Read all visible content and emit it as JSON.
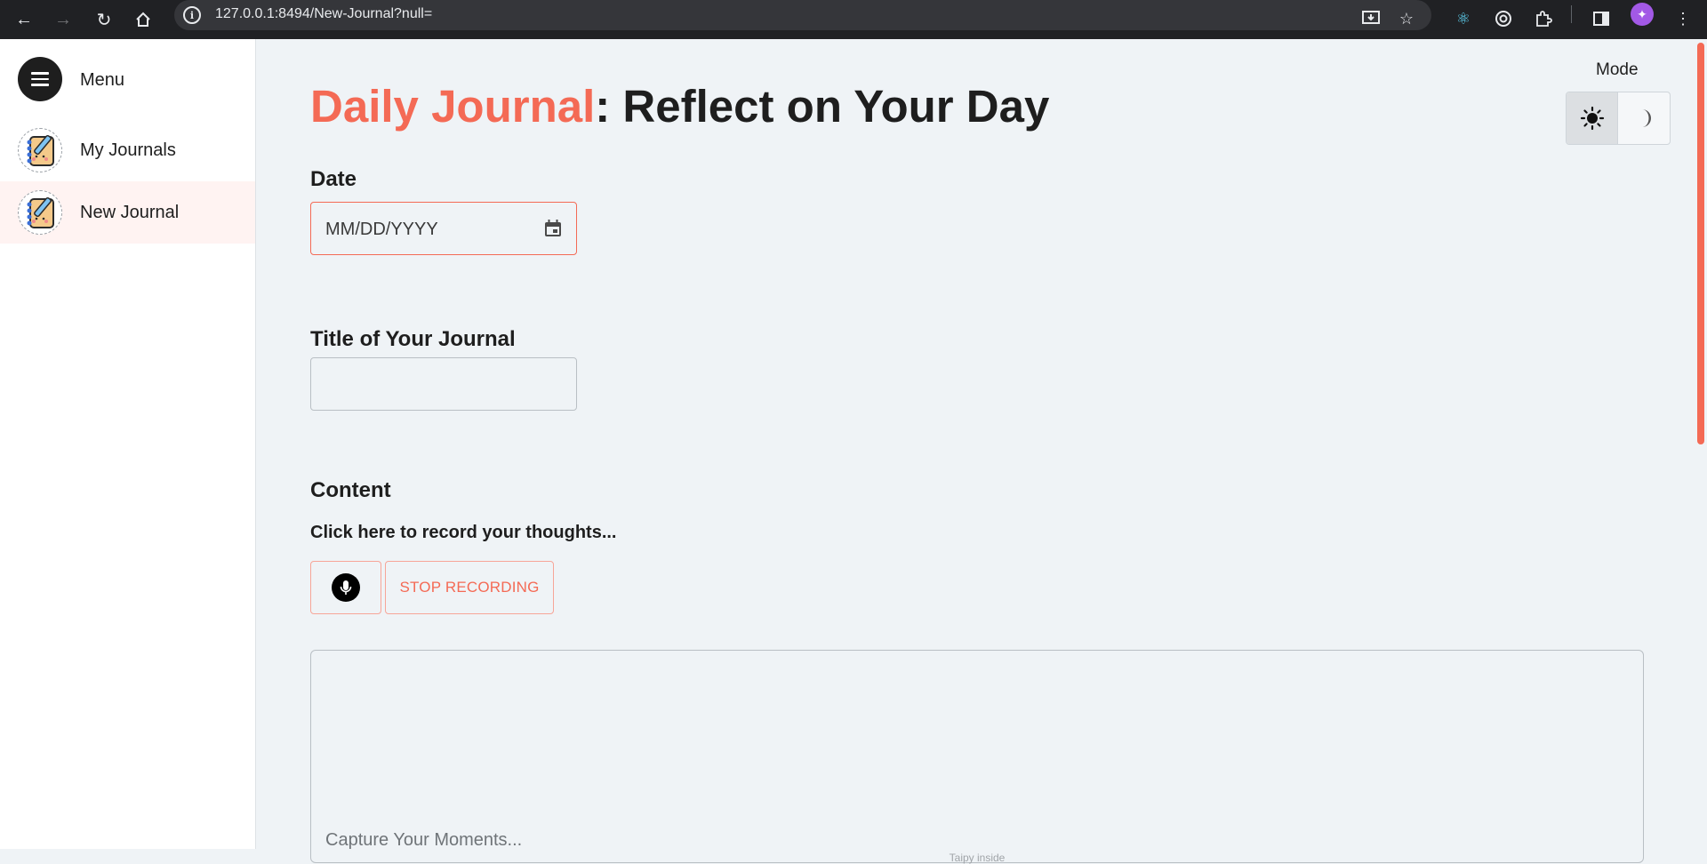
{
  "browser": {
    "url": "127.0.0.1:8494/New-Journal?null="
  },
  "sidebar": {
    "menu_label": "Menu",
    "items": [
      {
        "label": "My Journals",
        "icon": "journal-icon"
      },
      {
        "label": "New Journal",
        "icon": "journal-icon",
        "active": true
      }
    ]
  },
  "header": {
    "title_accent": "Daily Journal",
    "title_rest": ": Reflect on Your Day"
  },
  "mode": {
    "label": "Mode",
    "options": [
      "sun-icon",
      "moon-icon"
    ],
    "selected": "light"
  },
  "form": {
    "date_label": "Date",
    "date_placeholder": "MM/DD/YYYY",
    "title_label": "Title of Your Journal",
    "title_value": "",
    "content_label": "Content",
    "record_hint": "Click here to record your thoughts...",
    "stop_label": "STOP RECORDING",
    "content_placeholder": "Capture Your Moments...",
    "powered_by": "Taipy inside"
  },
  "colors": {
    "accent": "#f46a55",
    "background": "#eff3f6",
    "sidebar": "#ffffff",
    "active_item": "#fff3f2"
  }
}
